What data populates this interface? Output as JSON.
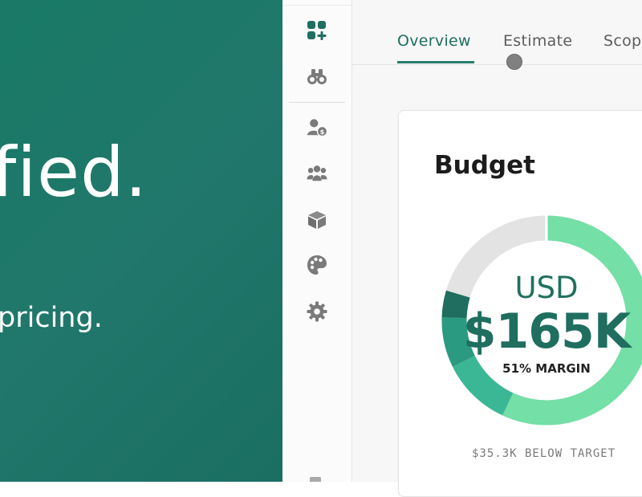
{
  "hero": {
    "headline": "fied.",
    "subline": "pricing."
  },
  "rail": {
    "icons": [
      "apps-add-icon",
      "binoculars-icon",
      "user-dollar-icon",
      "team-icon",
      "cube-icon",
      "palette-icon",
      "gear-icon"
    ]
  },
  "tabs": [
    {
      "label": "Overview",
      "active": true
    },
    {
      "label": "Estimate",
      "active": false
    },
    {
      "label": "Scop",
      "active": false
    }
  ],
  "budget": {
    "title": "Budget",
    "currency": "USD",
    "amount": "$165K",
    "margin_label": "51% MARGIN",
    "below_target": "$35.3K BELOW TARGET",
    "margin_percent": 51
  },
  "colors": {
    "hero_bg": "#1f776a",
    "accent": "#2a7d6c",
    "donut_light": "#74dfa6",
    "donut_mid": "#3bb795",
    "donut_dark1": "#2a9a80",
    "donut_dark2": "#1f6e5f",
    "donut_track": "#e3e3e3"
  }
}
